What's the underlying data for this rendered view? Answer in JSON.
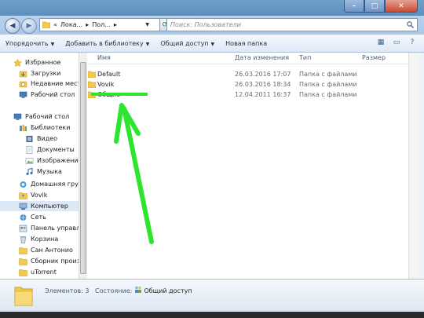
{
  "address": {
    "crumb_prefix": "«",
    "crumb1": "Лока...",
    "crumb2": "Пол...",
    "search_placeholder": "Поиск: Пользователи"
  },
  "window_controls": {
    "minimize": "–",
    "maximize": "□",
    "close": "✕"
  },
  "toolbar": {
    "organize": "Упорядочить",
    "add_library": "Добавить в библиотеку",
    "share": "Общий доступ",
    "new_folder": "Новая папка"
  },
  "sidebar": {
    "items": [
      {
        "label": "Избранное",
        "icon": "star-icon"
      },
      {
        "label": "Загрузки",
        "icon": "downloads-icon"
      },
      {
        "label": "Недавние места",
        "icon": "recent-places-icon"
      },
      {
        "label": "Рабочий стол",
        "icon": "desktop-icon"
      },
      {
        "label": "Рабочий стол",
        "icon": "desktop-icon"
      },
      {
        "label": "Библиотеки",
        "icon": "libraries-icon"
      },
      {
        "label": "Видео",
        "icon": "video-icon"
      },
      {
        "label": "Документы",
        "icon": "documents-icon"
      },
      {
        "label": "Изображения",
        "icon": "pictures-icon"
      },
      {
        "label": "Музыка",
        "icon": "music-icon"
      },
      {
        "label": "Домашняя групп",
        "icon": "homegroup-icon"
      },
      {
        "label": "Vovik",
        "icon": "user-folder-icon"
      },
      {
        "label": "Компьютер",
        "icon": "computer-icon"
      },
      {
        "label": "Сеть",
        "icon": "network-icon"
      },
      {
        "label": "Панель управле",
        "icon": "control-panel-icon"
      },
      {
        "label": "Корзина",
        "icon": "recycle-bin-icon"
      },
      {
        "label": "Сан Антонио",
        "icon": "folder-icon"
      },
      {
        "label": "Сборник произв",
        "icon": "folder-icon"
      },
      {
        "label": "uTorrent",
        "icon": "folder-icon"
      }
    ]
  },
  "columns": {
    "name": "Имя",
    "date": "Дата изменения",
    "type": "Тип",
    "size": "Размер"
  },
  "files": [
    {
      "name": "Default",
      "date": "26.03.2016 17:07",
      "type": "Папка с файлами"
    },
    {
      "name": "Vovik",
      "date": "26.03.2016 18:34",
      "type": "Папка с файлами"
    },
    {
      "name": "Общие",
      "date": "12.04.2011 16:37",
      "type": "Папка с файлами"
    }
  ],
  "status": {
    "items_label": "Элементов: 3",
    "state_label": "Состояние:",
    "state_value": "Общий доступ"
  },
  "colors": {
    "annotation": "#2ee52e",
    "titlebar": "#6fa0c9",
    "folder": "#f2c94c"
  }
}
